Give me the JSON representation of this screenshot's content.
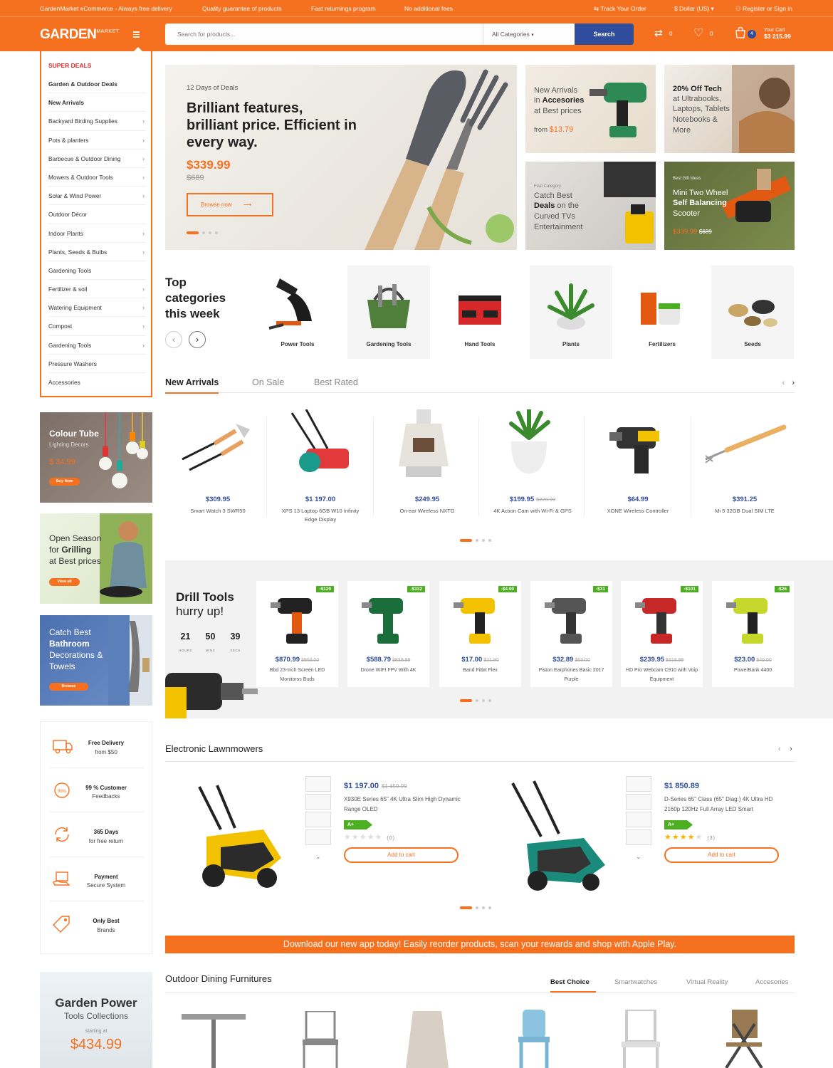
{
  "topbar": {
    "announce": [
      "GardenMarket eCommerce - Always free delivery",
      "Quality guarantee of products",
      "Fast returnings program",
      "No additional fees"
    ],
    "track": "Track Your Order",
    "currency": "$ Dollar (US)",
    "account": "Register or Sign in"
  },
  "header": {
    "logo": "GARDEN",
    "logo_sub": "MARKET",
    "search_placeholder": "Search for products...",
    "category": "All Categories",
    "search_btn": "Search",
    "compare_count": "0",
    "wishlist_count": "0",
    "cart_count": "4",
    "cart_label": "Your Cart",
    "cart_total": "$3 215.99"
  },
  "sidebar": {
    "head": "SUPER DEALS",
    "items": [
      {
        "label": "Garden & Outdoor Deals",
        "bold": true,
        "arrow": false
      },
      {
        "label": "New Arrivals",
        "bold": true,
        "arrow": false
      },
      {
        "label": "Backyard Birding Supplies",
        "arrow": true
      },
      {
        "label": "Pots & planters",
        "arrow": true
      },
      {
        "label": "Barbecue & Outdoor Dining",
        "arrow": true
      },
      {
        "label": "Mowers & Outdoor Tools",
        "arrow": true
      },
      {
        "label": "Solar & Wind Power",
        "arrow": true
      },
      {
        "label": "Outdoor Décor",
        "arrow": false
      },
      {
        "label": "Indoor Plants",
        "arrow": true
      },
      {
        "label": "Plants, Seeds & Bulbs",
        "arrow": true
      },
      {
        "label": "Gardening Tools",
        "arrow": false
      },
      {
        "label": "Fertilizer & soil",
        "arrow": true
      },
      {
        "label": "Watering Equipment",
        "arrow": true
      },
      {
        "label": "Compost",
        "arrow": true
      },
      {
        "label": "Gardening Tools",
        "arrow": true
      },
      {
        "label": "Pressure Washers",
        "arrow": false
      },
      {
        "label": "Accessories",
        "arrow": false
      }
    ]
  },
  "side_banners": {
    "colour_tube": {
      "title": "Colour Tube",
      "sub": "Lighting Decors",
      "price": "$ 34.99",
      "btn": "Buy Now"
    },
    "grilling": {
      "line1": "Open Season",
      "line2a": "for ",
      "line2b": "Grilling",
      "line3": "at Best prices",
      "btn": "View all"
    },
    "bathroom": {
      "line1": "Catch Best",
      "line2": "Bathroom",
      "line3": "Decorations &",
      "line4": "Towels",
      "btn": "Browse"
    }
  },
  "hero": {
    "kicker": "12 Days of Deals",
    "headline": "Brilliant features, brilliant price. Efficient in every way.",
    "price": "$339.99",
    "old_price": "$689",
    "button": "Browse now"
  },
  "promos": {
    "p1": {
      "l1": "New Arrivals",
      "l2a": "in ",
      "l2b": "Accesories",
      "l3": "at Best prices",
      "from": "from ",
      "price": "$13.79"
    },
    "p2": {
      "l1": "20% Off Tech",
      "l2": "at Ultrabooks,",
      "l3": "Laptops, Tablets",
      "l4": "Notebooks &",
      "l5": "More"
    },
    "p3": {
      "kicker": "Feat Category",
      "l1": "Catch Best",
      "l2a": "Deals",
      "l2b": " on the",
      "l3": "Curved TVs",
      "l4": "Entertainment"
    },
    "p4": {
      "kicker": "Best Gift Ideas",
      "l1": "Mini Two Wheel",
      "l2": "Self Balancing",
      "l3": "Scooter",
      "price": "$339.99",
      "old": "$689"
    }
  },
  "top_categories": {
    "title": "Top categories this week",
    "items": [
      "Power Tools",
      "Gardening Tools",
      "Hand Tools",
      "Plants",
      "Fertilizers",
      "Seeds"
    ]
  },
  "arrivals": {
    "tabs": [
      "New Arrivals",
      "On Sale",
      "Best Rated"
    ],
    "products": [
      {
        "price": "$309.95",
        "old": "",
        "name": "Smart Watch 3 SWR50"
      },
      {
        "price": "$1 197.00",
        "old": "",
        "name": "XPS 13 Laptop 6GB W10 Infinity Edge Display"
      },
      {
        "price": "$249.95",
        "old": "",
        "name": "On-ear Wireless NXTG"
      },
      {
        "price": "$199.95",
        "old": "$229.99",
        "name": "4K Action Cam with Wi-Fi & GPS"
      },
      {
        "price": "$64.99",
        "old": "",
        "name": "XONE Wireless Controller"
      },
      {
        "price": "$391.25",
        "old": "",
        "name": "Mi 5 32GB Dual SIM LTE"
      }
    ]
  },
  "drill": {
    "title": "Drill Tools",
    "sub": "hurry up!",
    "timer": [
      {
        "v": "21",
        "l": "HOURS"
      },
      {
        "v": "50",
        "l": "MINS"
      },
      {
        "v": "39",
        "l": "SECS"
      }
    ],
    "products": [
      {
        "badge": "-$129",
        "price": "$870.99",
        "old": "$959.00",
        "name": "Bbd 23-Inch Screen LED Monitorss Buds"
      },
      {
        "badge": "-$332",
        "price": "$588.79",
        "old": "$839.99",
        "name": "Drone WIFI FPV With 4K"
      },
      {
        "badge": "-$4.90",
        "price": "$17.00",
        "old": "$21.90",
        "name": "Band Fitbit Flex"
      },
      {
        "badge": "-$31",
        "price": "$32.89",
        "old": "$63.00",
        "name": "Piston Earphones Basic 2017 Purple"
      },
      {
        "badge": "-$101",
        "price": "$239.95",
        "old": "$318.99",
        "name": "HD Pro Webcam C910 with Voip Equipment"
      },
      {
        "badge": "-$26",
        "price": "$23.00",
        "old": "$49.00",
        "name": "PowerBank 4400"
      }
    ]
  },
  "features": [
    {
      "title": "Free Delivery",
      "sub": "from $50",
      "icon": "truck-icon"
    },
    {
      "title": "99 % Customer",
      "sub": "Feedbacks",
      "icon": "feedback-badge-icon"
    },
    {
      "title": "365 Days",
      "sub": "for free return",
      "icon": "return-cycle-icon"
    },
    {
      "title": "Payment",
      "sub": "Secure System",
      "icon": "secure-payment-icon"
    },
    {
      "title": "Only Best",
      "sub": "Brands",
      "icon": "price-tag-icon"
    }
  ],
  "lawnmowers": {
    "title": "Electronic Lawnmowers",
    "items": [
      {
        "price": "$1 197.00",
        "old": "$1 459.99",
        "desc": "X930E Series 65\" 4K Ultra Slim High Dynamic Range OLED",
        "energy": "A+",
        "stars": 0,
        "count": "(0)",
        "btn": "Add to cart"
      },
      {
        "price": "$1 850.89",
        "old": "",
        "desc": "D-Series 65\" Class (65\" Diag.) 4K Ultra HD 2160p 120Hz Full Array LED Smart",
        "energy": "A+",
        "stars": 4,
        "count": "(3)",
        "btn": "Add to cart"
      }
    ]
  },
  "app_banner": "Download our new app today! Easily reorder products, scan your rewards and shop with Apple Play.",
  "garden_power": {
    "t1": "Garden Power",
    "t2": "Tools Collections",
    "t3": "starting at",
    "t4": "$434.99"
  },
  "outdoor": {
    "title": "Outdoor Dining Furnitures",
    "tabs": [
      "Best Choice",
      "Smartwatches",
      "Virtual Reality",
      "Accesories"
    ]
  },
  "colors": {
    "accent": "#f5701f",
    "brand_blue": "#2f4d9c",
    "badge_green": "#4caf21"
  }
}
